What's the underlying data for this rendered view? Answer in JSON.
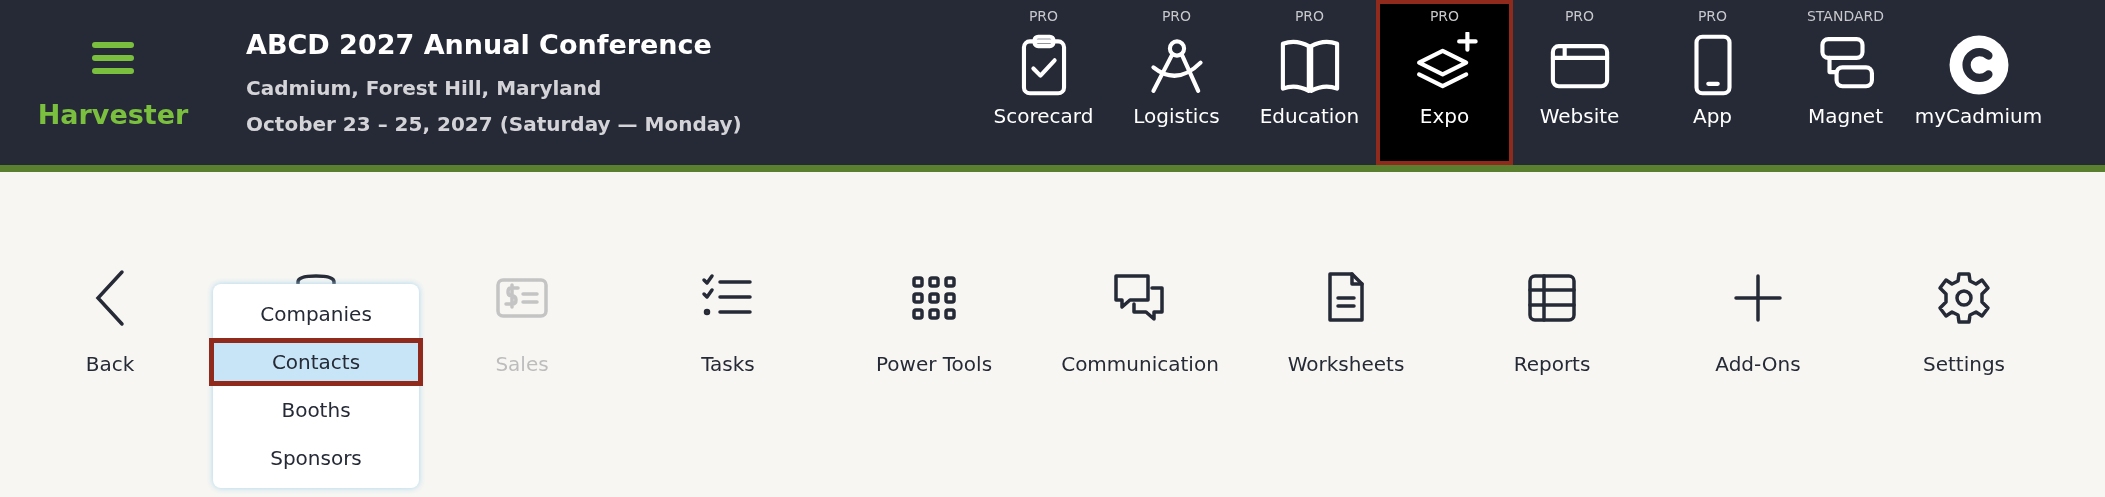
{
  "brand": {
    "name": "Harvester"
  },
  "event": {
    "title": "ABCD 2027 Annual Conference",
    "location": "Cadmium, Forest Hill, Maryland",
    "dates": "October 23 – 25, 2027 (Saturday — Monday)"
  },
  "products": [
    {
      "tier": "PRO",
      "label": "Scorecard",
      "selected": false
    },
    {
      "tier": "PRO",
      "label": "Logistics",
      "selected": false
    },
    {
      "tier": "PRO",
      "label": "Education",
      "selected": false
    },
    {
      "tier": "PRO",
      "label": "Expo",
      "selected": true
    },
    {
      "tier": "PRO",
      "label": "Website",
      "selected": false
    },
    {
      "tier": "PRO",
      "label": "App",
      "selected": false
    },
    {
      "tier": "STANDARD",
      "label": "Magnet",
      "selected": false
    },
    {
      "label": "myCadmium",
      "selected": false
    }
  ],
  "nav": [
    {
      "kind": "back",
      "label": "Back"
    },
    {
      "kind": "menu",
      "menu": [
        {
          "label": "Companies",
          "selected": false
        },
        {
          "label": "Contacts",
          "selected": true
        },
        {
          "label": "Booths",
          "selected": false
        },
        {
          "label": "Sponsors",
          "selected": false
        }
      ]
    },
    {
      "kind": "item",
      "label": "Sales",
      "disabled": true
    },
    {
      "kind": "item",
      "label": "Tasks",
      "disabled": false
    },
    {
      "kind": "item",
      "label": "Power Tools",
      "disabled": false
    },
    {
      "kind": "item",
      "label": "Communication",
      "disabled": false
    },
    {
      "kind": "item",
      "label": "Worksheets",
      "disabled": false
    },
    {
      "kind": "item",
      "label": "Reports",
      "disabled": false
    },
    {
      "kind": "item",
      "label": "Add-Ons",
      "disabled": false
    },
    {
      "kind": "item",
      "label": "Settings",
      "disabled": false
    }
  ]
}
